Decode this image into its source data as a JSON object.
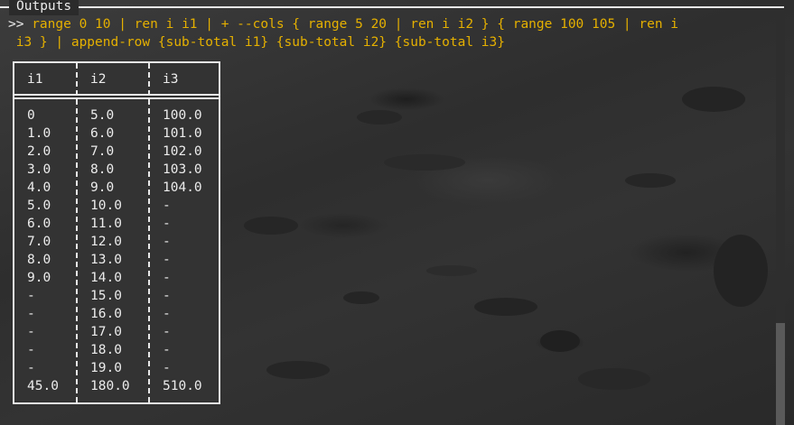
{
  "panel": {
    "title": "Outputs"
  },
  "command": {
    "prompt": ">>",
    "line1": " range 0 10 | ren i i1 | + --cols { range 5 20 | ren i i2 } { range 100 105 | ren i",
    "line2": " i3 } | append-row {sub-total i1} {sub-total i2} {sub-total i3}"
  },
  "table": {
    "headers": [
      "i1",
      "i2",
      "i3"
    ],
    "rows": [
      [
        "0",
        "5.0",
        "100.0"
      ],
      [
        "1.0",
        "6.0",
        "101.0"
      ],
      [
        "2.0",
        "7.0",
        "102.0"
      ],
      [
        "3.0",
        "8.0",
        "103.0"
      ],
      [
        "4.0",
        "9.0",
        "104.0"
      ],
      [
        "5.0",
        "10.0",
        "-"
      ],
      [
        "6.0",
        "11.0",
        "-"
      ],
      [
        "7.0",
        "12.0",
        "-"
      ],
      [
        "8.0",
        "13.0",
        "-"
      ],
      [
        "9.0",
        "14.0",
        "-"
      ],
      [
        "-",
        "15.0",
        "-"
      ],
      [
        "-",
        "16.0",
        "-"
      ],
      [
        "-",
        "17.0",
        "-"
      ],
      [
        "-",
        "18.0",
        "-"
      ],
      [
        "-",
        "19.0",
        "-"
      ],
      [
        "45.0",
        "180.0",
        "510.0"
      ]
    ]
  },
  "colors": {
    "command_text": "#e5b000",
    "foreground": "#ececec",
    "border": "#e8e8e8"
  }
}
